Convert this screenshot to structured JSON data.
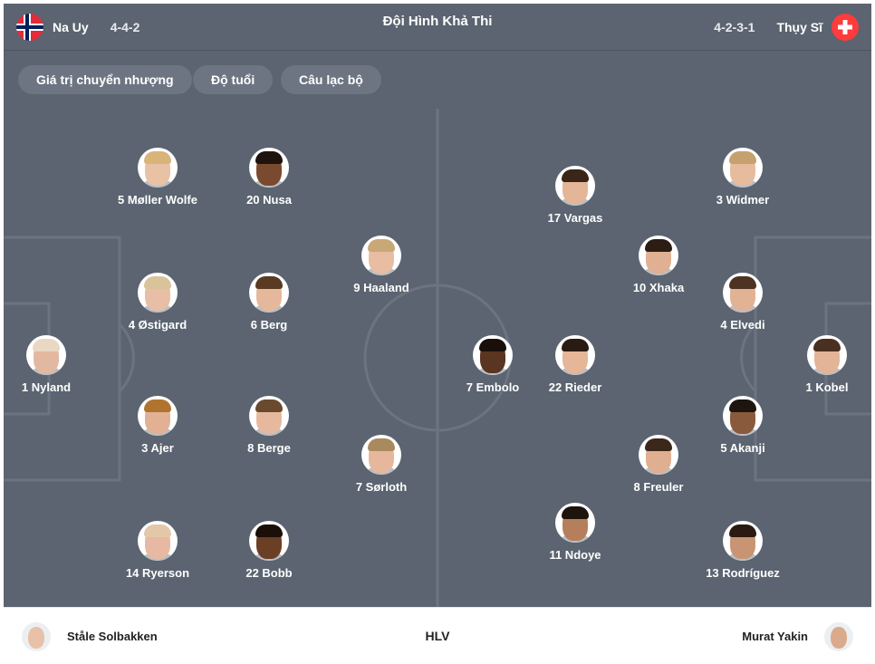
{
  "header": {
    "title": "Đội Hình Khả Thi",
    "home": {
      "name": "Na Uy",
      "formation": "4-4-2",
      "flag_icon": "norway-flag-icon"
    },
    "away": {
      "name": "Thụy Sĩ",
      "formation": "4-2-3-1",
      "flag_icon": "switzerland-flag-icon"
    }
  },
  "filters": [
    "Giá trị chuyển nhượng",
    "Độ tuổi",
    "Câu lạc bộ"
  ],
  "home_players": [
    {
      "label": "1 Nyland",
      "skin": "#e2b9a0",
      "hair": "#e9d9c4"
    },
    {
      "label": "4 Østigard",
      "skin": "#e8bfa6",
      "hair": "#d9c39a"
    },
    {
      "label": "6 Berg",
      "skin": "#e5b89c",
      "hair": "#5a3a22"
    },
    {
      "label": "3 Ajer",
      "skin": "#e2b093",
      "hair": "#b0742f"
    },
    {
      "label": "8 Berge",
      "skin": "#e6b99e",
      "hair": "#6a4a2e"
    },
    {
      "label": "5 Møller Wolfe",
      "skin": "#e9c2a6",
      "hair": "#d8b47a"
    },
    {
      "label": "20 Nusa",
      "skin": "#7a4a2e",
      "hair": "#1f140d"
    },
    {
      "label": "14 Ryerson",
      "skin": "#e8b9a2",
      "hair": "#e3c7a9"
    },
    {
      "label": "22 Bobb",
      "skin": "#6b3f26",
      "hair": "#1a1009"
    },
    {
      "label": "9 Haaland",
      "skin": "#e8bda2",
      "hair": "#c9a877"
    },
    {
      "label": "7 Sørloth",
      "skin": "#e6b79d",
      "hair": "#a98a5e"
    }
  ],
  "away_players": [
    {
      "label": "1 Kobel",
      "skin": "#e3b497",
      "hair": "#4a3020"
    },
    {
      "label": "3 Widmer",
      "skin": "#e7bb9e",
      "hair": "#c7a070"
    },
    {
      "label": "4 Elvedi",
      "skin": "#e2b294",
      "hair": "#4e3322"
    },
    {
      "label": "5 Akanji",
      "skin": "#8a5a3c",
      "hair": "#1e1510"
    },
    {
      "label": "13 Rodríguez",
      "skin": "#c89474",
      "hair": "#2a1a12"
    },
    {
      "label": "10 Xhaka",
      "skin": "#dfb092",
      "hair": "#2c1d14"
    },
    {
      "label": "8 Freuler",
      "skin": "#e0ae90",
      "hair": "#3b281b"
    },
    {
      "label": "17 Vargas",
      "skin": "#e4b597",
      "hair": "#3a2518"
    },
    {
      "label": "22 Rieder",
      "skin": "#e5b698",
      "hair": "#2a1b12"
    },
    {
      "label": "11 Ndoye",
      "skin": "#b57f5d",
      "hair": "#1e140e"
    },
    {
      "label": "7 Embolo",
      "skin": "#5a3522",
      "hair": "#1a100a"
    }
  ],
  "footer": {
    "home_coach": "Ståle Solbakken",
    "label": "HLV",
    "away_coach": "Murat Yakin"
  },
  "colors": {
    "pitch": "#5b6470",
    "lines": "#6b7480",
    "norway_red": "#e32b3a",
    "norway_blue": "#00205b",
    "swiss_red": "#ff3b3b"
  }
}
